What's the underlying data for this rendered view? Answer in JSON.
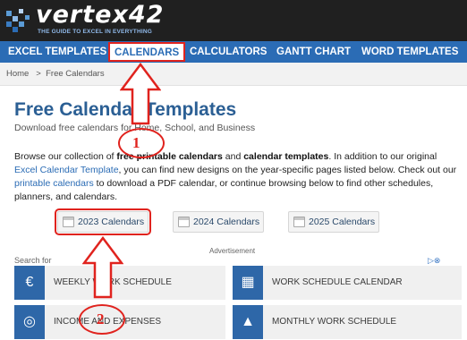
{
  "brand": {
    "name": "vertex42",
    "tagline": "THE GUIDE TO EXCEL IN EVERYTHING"
  },
  "nav": {
    "items": [
      {
        "label": "EXCEL TEMPLATES"
      },
      {
        "label": "CALENDARS",
        "active": true
      },
      {
        "label": "CALCULATORS"
      },
      {
        "label": "GANTT CHART"
      },
      {
        "label": "WORD TEMPLATES"
      }
    ]
  },
  "breadcrumb": {
    "home": "Home",
    "separator": ">",
    "current": "Free Calendars"
  },
  "page": {
    "title": "Free Calendar Templates",
    "subtitle": "Download free calendars for Home, School, and Business"
  },
  "intro": {
    "t1": "Browse our collection of ",
    "b1": "free printable calendars",
    "t2": " and ",
    "b2": "calendar templates",
    "t3": ". In addition to our original ",
    "l1": "Excel Calendar Template",
    "t4": ", you can find new designs on the year-specific pages listed below. Check out our ",
    "l2": "printable calendars",
    "t5": " to download a PDF calendar, or continue browsing below to find other schedules, planners, and calendars."
  },
  "years": [
    {
      "label": "2023 Calendars"
    },
    {
      "label": "2024 Calendars"
    },
    {
      "label": "2025 Calendars"
    }
  ],
  "ads": {
    "advertisement_label": "Advertisement",
    "search_for_label": "Search for",
    "tiles": [
      {
        "label": "WEEKLY WORK SCHEDULE",
        "icon": "euro-bag-icon"
      },
      {
        "label": "WORK SCHEDULE CALENDAR",
        "icon": "calculator-icon"
      },
      {
        "label": "INCOME AND EXPENSES",
        "icon": "coins-icon"
      },
      {
        "label": "MONTHLY WORK SCHEDULE",
        "icon": "graduation-cap-icon"
      }
    ]
  },
  "annotations": {
    "step1": "1",
    "step2": "2"
  },
  "colors": {
    "header_bg": "#202020",
    "nav_bg": "#2b6cb5",
    "title": "#2b5f94",
    "annotation": "#e0231e",
    "tile_icon_bg": "#2e67a8"
  }
}
